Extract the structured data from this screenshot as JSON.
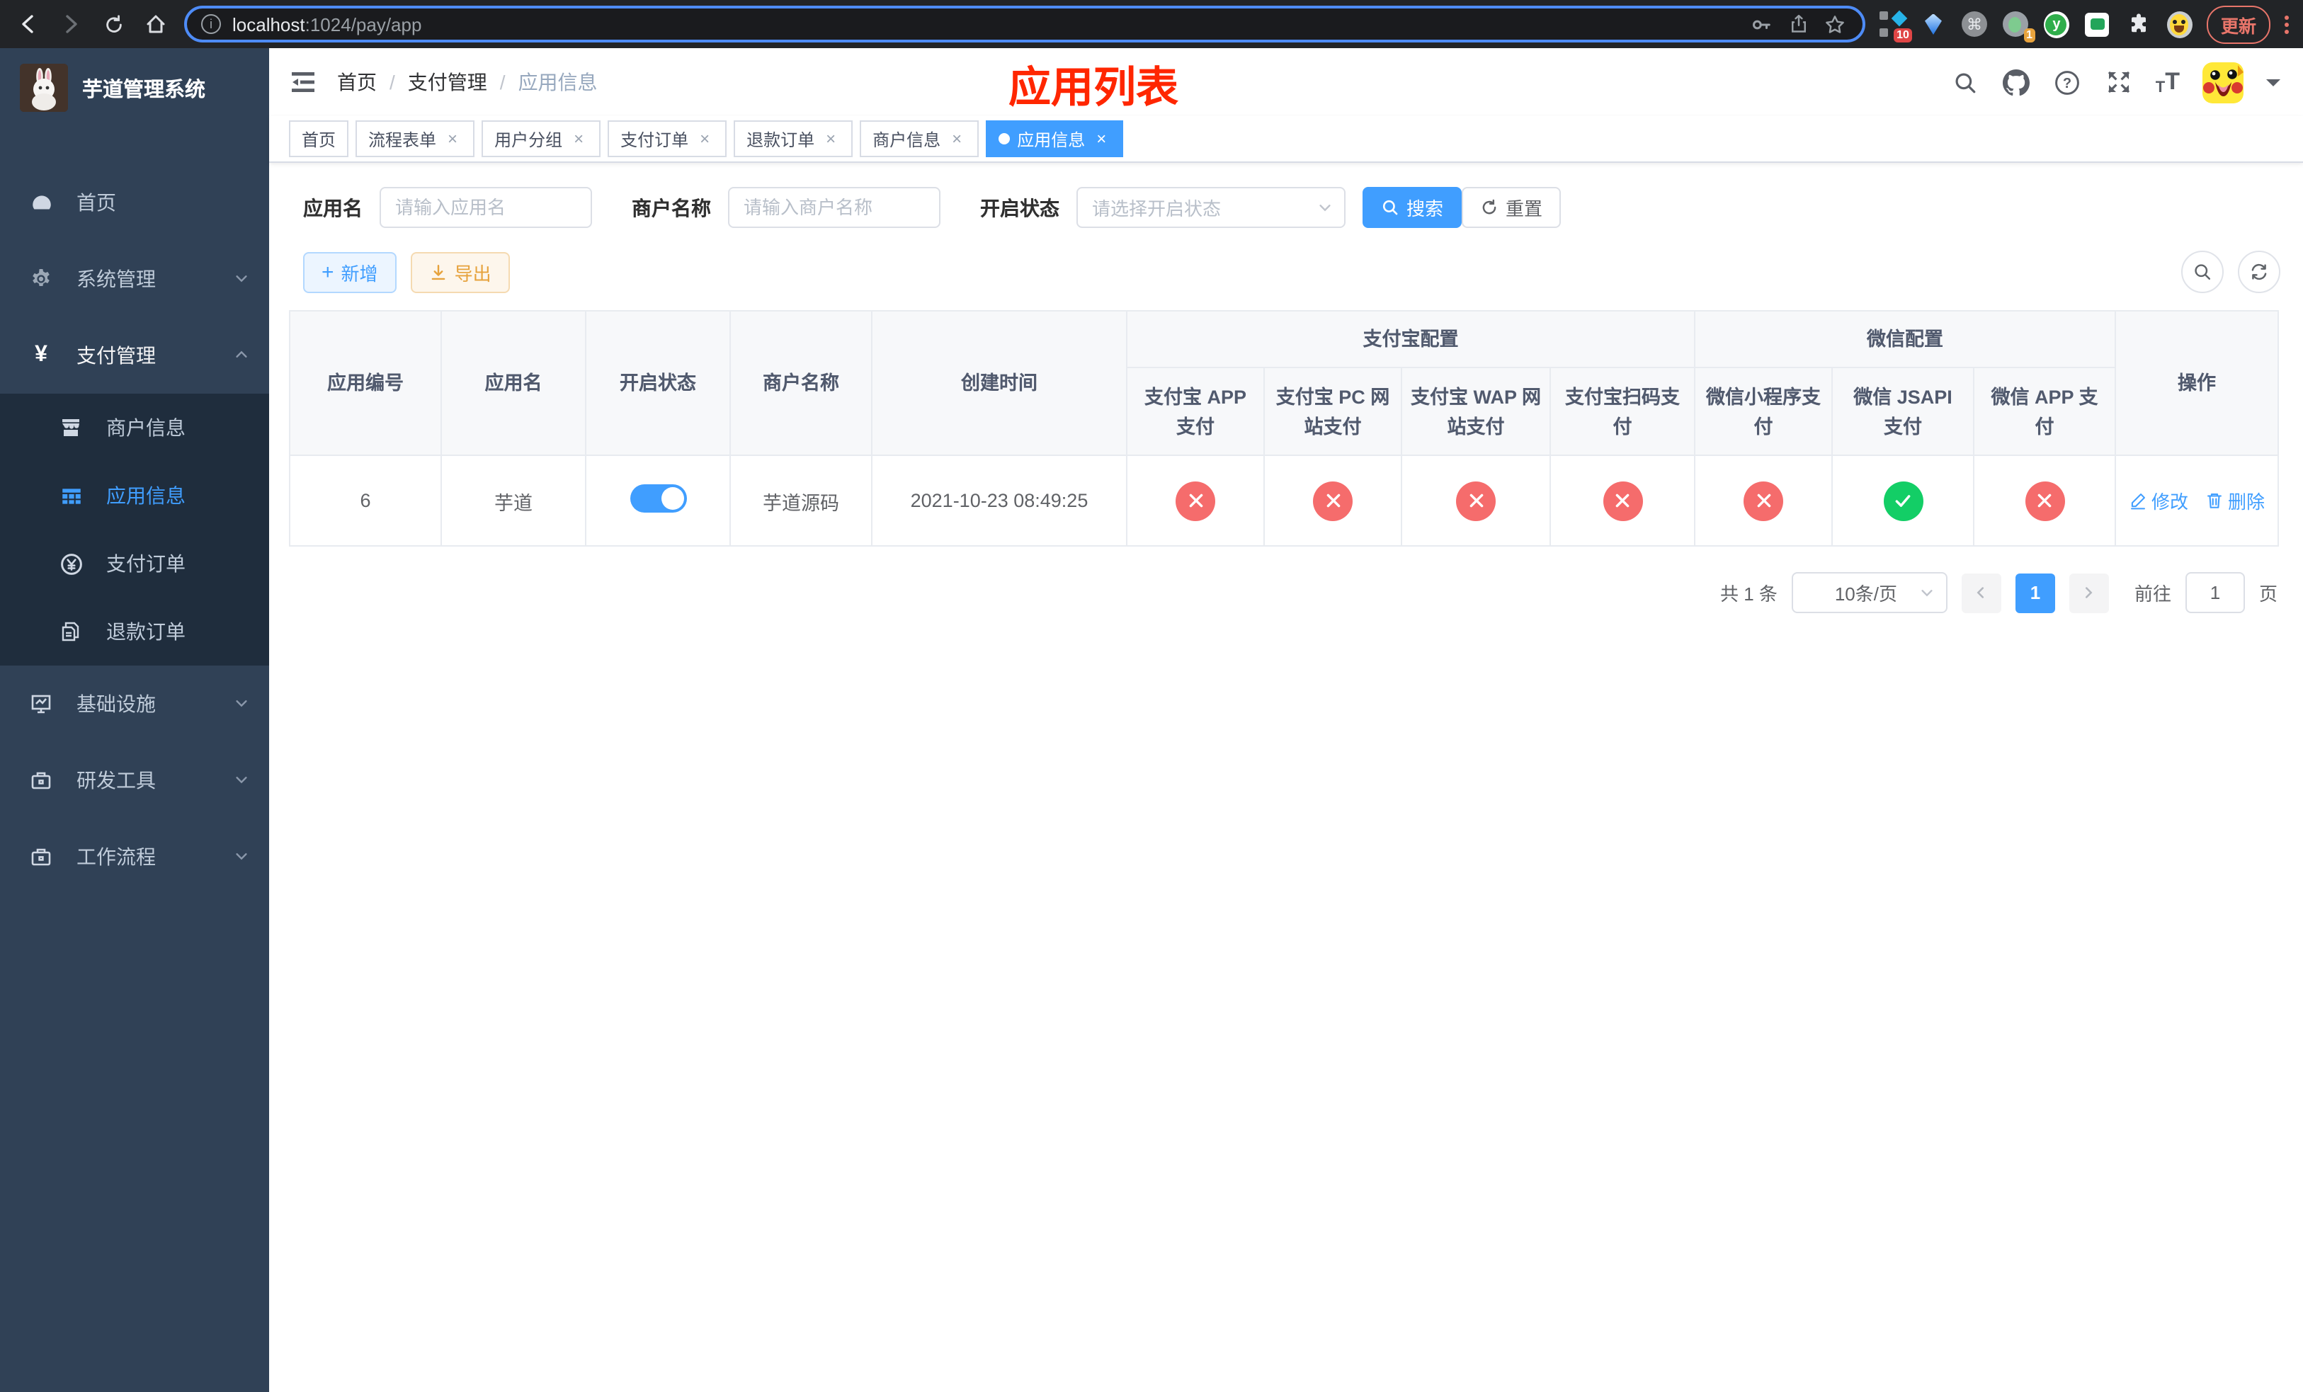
{
  "browser": {
    "url_host": "localhost",
    "url_rest": ":1024/pay/app",
    "update_label": "更新",
    "ext_badge_10": "10",
    "ext_badge_1": "1",
    "ext_y_label": "y"
  },
  "sidebar": {
    "title": "芋道管理系统",
    "items": [
      {
        "label": "首页",
        "icon": "dashboard-icon"
      },
      {
        "label": "系统管理",
        "icon": "gear-icon"
      },
      {
        "label": "支付管理",
        "icon": "yen-icon"
      },
      {
        "label": "基础设施",
        "icon": "monitor-icon"
      },
      {
        "label": "研发工具",
        "icon": "toolbox-icon"
      },
      {
        "label": "工作流程",
        "icon": "toolbox-icon"
      }
    ],
    "submenu": [
      {
        "label": "商户信息",
        "icon": "shop-icon"
      },
      {
        "label": "应用信息",
        "icon": "grid-icon",
        "active": true
      },
      {
        "label": "支付订单",
        "icon": "pay-order-icon"
      },
      {
        "label": "退款订单",
        "icon": "refund-icon"
      }
    ]
  },
  "header": {
    "breadcrumb": [
      {
        "label": "首页"
      },
      {
        "label": "支付管理"
      },
      {
        "label": "应用信息"
      }
    ],
    "annotation": "应用列表"
  },
  "tabs": [
    {
      "label": "首页",
      "closable": false,
      "active": false
    },
    {
      "label": "流程表单",
      "closable": true,
      "active": false
    },
    {
      "label": "用户分组",
      "closable": true,
      "active": false
    },
    {
      "label": "支付订单",
      "closable": true,
      "active": false
    },
    {
      "label": "退款订单",
      "closable": true,
      "active": false
    },
    {
      "label": "商户信息",
      "closable": true,
      "active": false
    },
    {
      "label": "应用信息",
      "closable": true,
      "active": true
    }
  ],
  "filters": {
    "app_name_label": "应用名",
    "app_name_placeholder": "请输入应用名",
    "merchant_label": "商户名称",
    "merchant_placeholder": "请输入商户名称",
    "status_label": "开启状态",
    "status_placeholder": "请选择开启状态",
    "search_label": "搜索",
    "reset_label": "重置"
  },
  "toolbar": {
    "add_label": "新增",
    "export_label": "导出"
  },
  "table": {
    "columns": [
      "应用编号",
      "应用名",
      "开启状态",
      "商户名称",
      "创建时间"
    ],
    "group_alipay": {
      "label": "支付宝配置",
      "cols": [
        "支付宝 APP 支付",
        "支付宝 PC 网站支付",
        "支付宝 WAP 网站支付",
        "支付宝扫码支付"
      ]
    },
    "group_wechat": {
      "label": "微信配置",
      "cols": [
        "微信小程序支付",
        "微信 JSAPI 支付",
        "微信 APP 支付"
      ]
    },
    "action_label": "操作",
    "row": {
      "id": "6",
      "name": "芋道",
      "enabled": true,
      "merchant": "芋道源码",
      "created": "2021-10-23 08:49:25",
      "statuses": [
        "error",
        "error",
        "error",
        "error",
        "error",
        "success",
        "error"
      ],
      "edit_label": "修改",
      "delete_label": "删除"
    }
  },
  "pagination": {
    "total_text": "共 1 条",
    "page_size_text": "10条/页",
    "current_page": "1",
    "goto_label": "前往",
    "goto_value": "1",
    "page_suffix": "页"
  },
  "colors": {
    "accent": "#409eff",
    "danger": "#f56c6c",
    "success": "#13ce66",
    "warning": "#e6a23c",
    "annotation_red": "#ff2600",
    "sidebar_bg": "#304156",
    "submenu_bg": "#1f2d3d"
  }
}
